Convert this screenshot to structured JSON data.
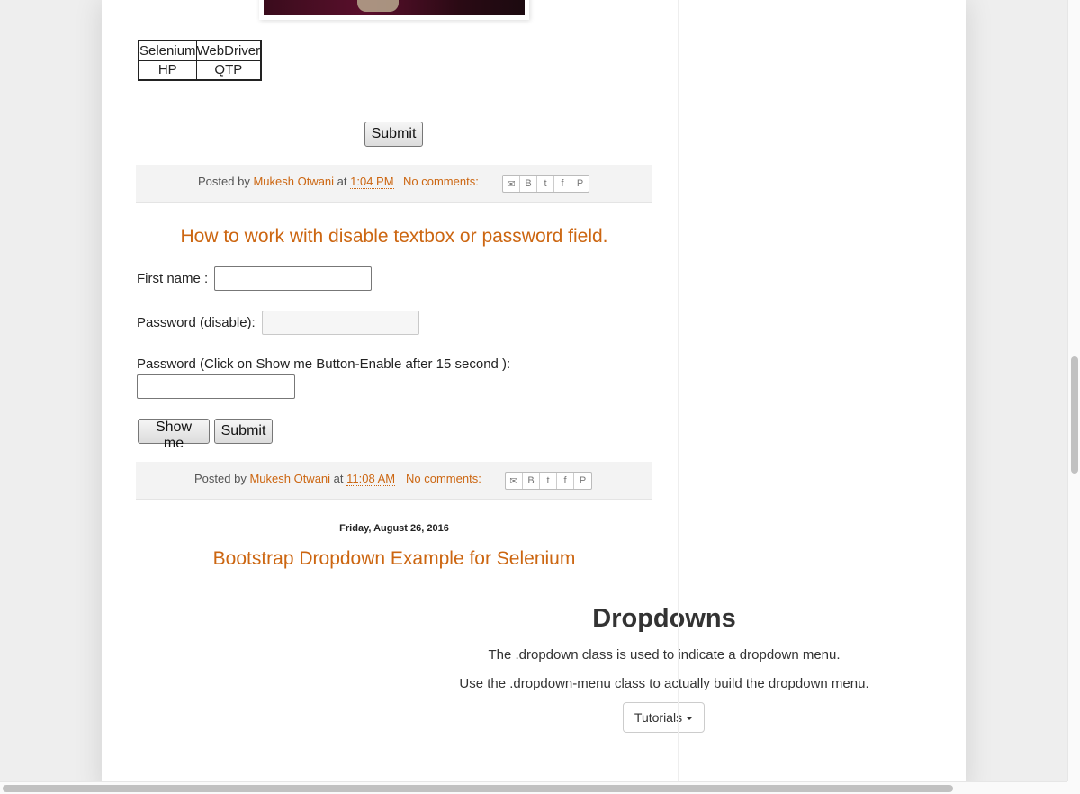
{
  "table": {
    "rows": [
      [
        "Selenium",
        "WebDriver"
      ],
      [
        "HP",
        "QTP"
      ]
    ]
  },
  "buttons": {
    "submit_top": "Submit",
    "show_me": "Show me",
    "submit_bottom": "Submit"
  },
  "post1_footer": {
    "posted_by": "Posted by",
    "author": "Mukesh Otwani",
    "at": "at",
    "time": "1:04 PM",
    "comments": "No comments:"
  },
  "post2": {
    "title": "How to work with disable textbox or password field.",
    "first_name_label": "First name :",
    "password_disabled_label": "Password (disable):",
    "password_enable_label": "Password (Click on Show me Button-Enable after 15 second ):"
  },
  "post2_footer": {
    "posted_by": "Posted by",
    "author": "Mukesh Otwani",
    "at": "at",
    "time": "11:08 AM",
    "comments": "No comments:"
  },
  "date_header": "Friday, August 26, 2016",
  "post3": {
    "title": "Bootstrap Dropdown Example for Selenium",
    "heading": "Dropdowns",
    "line1": "The .dropdown class is used to indicate a dropdown menu.",
    "line2": "Use the .dropdown-menu class to actually build the dropdown menu.",
    "dropdown_label": "Tutorials"
  },
  "share_icons": [
    "email-icon",
    "blogger-icon",
    "twitter-icon",
    "facebook-icon",
    "pinterest-icon"
  ],
  "colors": {
    "accent": "#cc6611",
    "footer_bg": "#f3f3f3",
    "page_bg": "#eeeeee"
  }
}
